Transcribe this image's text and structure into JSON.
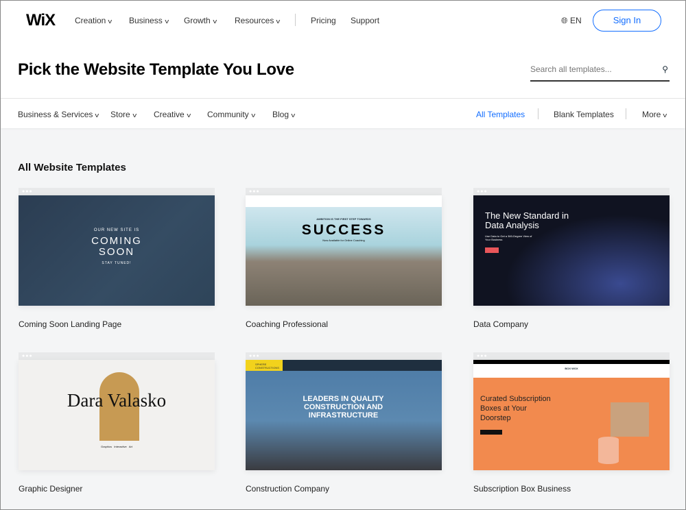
{
  "header": {
    "logo": "WiX",
    "nav": [
      "Creation",
      "Business",
      "Growth",
      "Resources"
    ],
    "links": [
      "Pricing",
      "Support"
    ],
    "language": "EN",
    "sign_in": "Sign In"
  },
  "hero": {
    "title": "Pick the Website Template You Love",
    "search_placeholder": "Search all templates..."
  },
  "categories": {
    "items": [
      "Business & Services",
      "Store",
      "Creative",
      "Community",
      "Blog"
    ],
    "all": "All Templates",
    "blank": "Blank Templates",
    "more": "More"
  },
  "section_title": "All Website Templates",
  "accent": "#116dff",
  "templates": [
    {
      "name": "Coming Soon Landing Page",
      "preview": {
        "small": "OUR NEW SITE IS",
        "headline": "COMING SOON",
        "sub": "STAY TUNED!"
      }
    },
    {
      "name": "Coaching Professional",
      "preview": {
        "small": "AMBITION IS THE FIRST STEP TOWARDS",
        "headline": "SUCCESS",
        "sub": "Now Available for Online Coaching"
      }
    },
    {
      "name": "Data Company",
      "preview": {
        "headline": "The New Standard in Data Analysis",
        "sub": "Use Data to Get a 360-Degree View of Your Business"
      }
    },
    {
      "name": "Graphic Designer",
      "preview": {
        "headline": "Dara Valasko",
        "sub": "Graphics   Interactive   Art"
      }
    },
    {
      "name": "Construction Company",
      "preview": {
        "small": "SPHERE CONSTRUCTIONS",
        "headline": "LEADERS IN QUALITY CONSTRUCTION AND INFRASTRUCTURE"
      }
    },
    {
      "name": "Subscription Box Business",
      "preview": {
        "small": "BOX WOX",
        "headline": "Curated Subscription Boxes at Your Doorstep"
      }
    }
  ]
}
